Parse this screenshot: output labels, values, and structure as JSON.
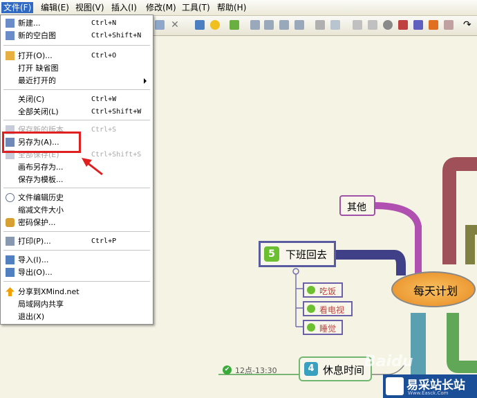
{
  "menubar": {
    "items": [
      {
        "label": "文件(F)"
      },
      {
        "label": "编辑(E)"
      },
      {
        "label": "视图(V)"
      },
      {
        "label": "插入(I)"
      },
      {
        "label": "修改(M)"
      },
      {
        "label": "工具(T)"
      },
      {
        "label": "帮助(H)"
      }
    ]
  },
  "file_menu": {
    "new": {
      "label": "新建...",
      "shortcut": "Ctrl+N"
    },
    "new_blank": {
      "label": "新的空白图",
      "shortcut": "Ctrl+Shift+N"
    },
    "open": {
      "label": "打开(O)...",
      "shortcut": "Ctrl+O"
    },
    "open_default": {
      "label": "打开 缺省图"
    },
    "recent": {
      "label": "最近打开的"
    },
    "close": {
      "label": "关闭(C)",
      "shortcut": "Ctrl+W"
    },
    "close_all": {
      "label": "全部关闭(L)",
      "shortcut": "Ctrl+Shift+W"
    },
    "save_new_version": {
      "label": "保存新的版本",
      "shortcut": "Ctrl+S"
    },
    "save_as": {
      "label": "另存为(A)..."
    },
    "save_all": {
      "label": "全部保存(E)",
      "shortcut": "Ctrl+Shift+S"
    },
    "save_canvas_as": {
      "label": "画布另存为..."
    },
    "save_as_template": {
      "label": "保存为模板..."
    },
    "history": {
      "label": "文件编辑历史"
    },
    "shrink": {
      "label": "缩减文件大小"
    },
    "password": {
      "label": "密码保护..."
    },
    "print": {
      "label": "打印(P)...",
      "shortcut": "Ctrl+P"
    },
    "import": {
      "label": "导入(I)..."
    },
    "export": {
      "label": "导出(O)..."
    },
    "share": {
      "label": "分享到XMind.net"
    },
    "lan_share": {
      "label": "局域网内共享"
    },
    "exit": {
      "label": "退出(X)"
    }
  },
  "mindmap": {
    "central": "每天计划",
    "other": "其他",
    "node5_num": "5",
    "node5": "下班回去",
    "sub1": "吃饭",
    "sub2": "看电视",
    "sub3": "睡觉",
    "node4_num": "4",
    "node4": "休息时间",
    "time_label": "12点-13:30"
  },
  "watermark": {
    "baidu": "Baidu",
    "site": "易采站长站",
    "url": "Www.Easck.Com"
  },
  "colors": {
    "menu_highlight": "#316ac5",
    "annotation_red": "#e02020",
    "central_fill": "#f0a030",
    "node_border": "#5a5aa0"
  }
}
